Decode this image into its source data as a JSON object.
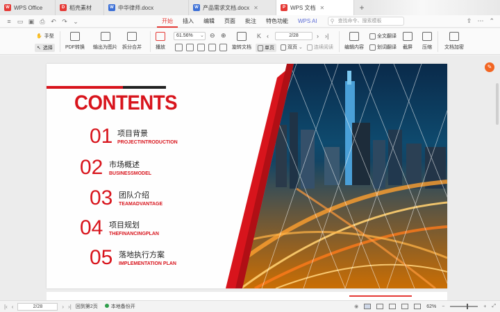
{
  "tabs": [
    {
      "label": "WPS Office",
      "icon": "wps-icon",
      "active": false
    },
    {
      "label": "稻壳素材",
      "icon": "docer-icon",
      "active": false
    },
    {
      "label": "中华律师.docx",
      "icon": "word-icon",
      "active": false
    },
    {
      "label": "产品需求文档.docx",
      "icon": "word-icon",
      "active": false
    },
    {
      "label": "WPS 文档",
      "icon": "pdf-icon",
      "active": true
    }
  ],
  "menu": {
    "items": [
      "开始",
      "插入",
      "编辑",
      "页面",
      "批注",
      "特色功能"
    ],
    "active": "开始",
    "ai_label": "WPS AI",
    "search_placeholder": "查找命令、搜索模板"
  },
  "ribbon": {
    "hand_tool": "手型",
    "select_tool": "选择",
    "pdf_convert": "PDF转换",
    "export_image": "输出为图片",
    "split_merge": "拆分合并",
    "play": "播放",
    "zoom_value": "61.56%",
    "page_value": "2/28",
    "rotate_doc": "旋转文档",
    "single_page": "单页",
    "double_page": "双页",
    "continuous": "连续阅读",
    "edit_content": "编辑内容",
    "full_translate": "全文翻译",
    "word_translate": "划词翻译",
    "screenshot": "截屏",
    "compress": "压缩",
    "doc_encrypt": "文档加密"
  },
  "slide": {
    "heading": "CONTENTS",
    "items": [
      {
        "num": "01",
        "cn": "项目背景",
        "en": "PROJECTINTRODUCTION"
      },
      {
        "num": "02",
        "cn": "市场概述",
        "en": "BUSINESSMODEL"
      },
      {
        "num": "03",
        "cn": "团队介绍",
        "en": "TEAMADVANTAGE"
      },
      {
        "num": "04",
        "cn": "项目规划",
        "en": "THEFINANCINGPLAN"
      },
      {
        "num": "05",
        "cn": "落地执行方案",
        "en": "IMPLEMENTATION PLAN"
      }
    ]
  },
  "statusbar": {
    "page": "2/28",
    "back_to_page": "回到第2页",
    "backup": "本地备份开",
    "zoom": "62%"
  },
  "colors": {
    "accent": "#e53935",
    "heading_red": "#d8141c"
  }
}
